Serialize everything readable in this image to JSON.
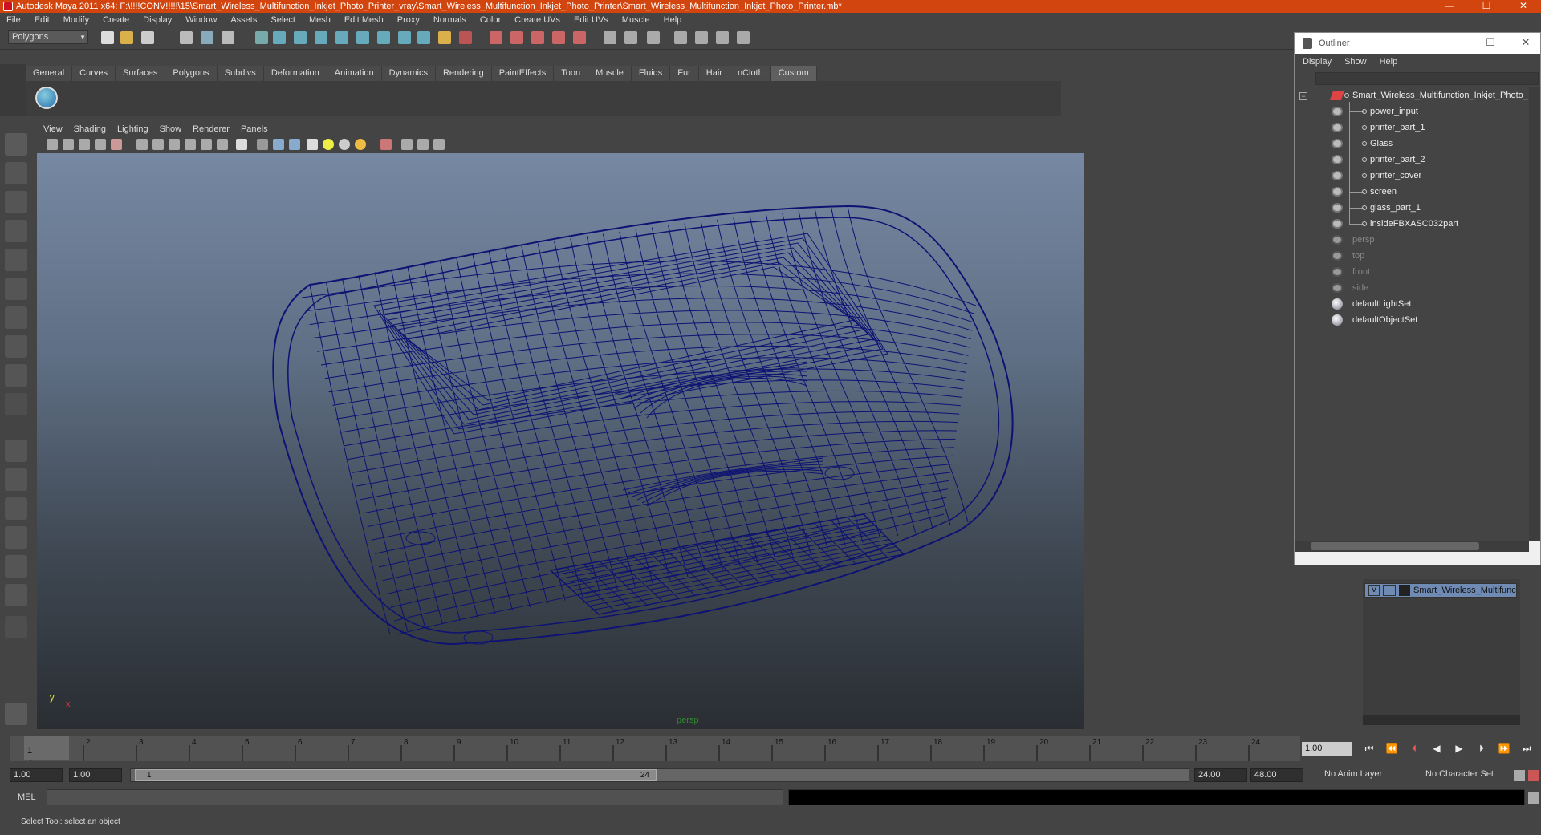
{
  "window": {
    "title": "Autodesk Maya 2011 x64: F:\\!!!!CONV!!!!!\\15\\Smart_Wireless_Multifunction_Inkjet_Photo_Printer_vray\\Smart_Wireless_Multifunction_Inkjet_Photo_Printer\\Smart_Wireless_Multifunction_Inkjet_Photo_Printer.mb*",
    "minimize": "—",
    "maximize": "☐",
    "close": "✕"
  },
  "menu": [
    "File",
    "Edit",
    "Modify",
    "Create",
    "Display",
    "Window",
    "Assets",
    "Select",
    "Mesh",
    "Edit Mesh",
    "Proxy",
    "Normals",
    "Color",
    "Create UVs",
    "Edit UVs",
    "Muscle",
    "Help"
  ],
  "mode_selector": "Polygons",
  "shelf_tabs": [
    "General",
    "Curves",
    "Surfaces",
    "Polygons",
    "Subdivs",
    "Deformation",
    "Animation",
    "Dynamics",
    "Rendering",
    "PaintEffects",
    "Toon",
    "Muscle",
    "Fluids",
    "Fur",
    "Hair",
    "nCloth",
    "Custom"
  ],
  "active_shelf_tab": "Custom",
  "viewport": {
    "menu": [
      "View",
      "Shading",
      "Lighting",
      "Show",
      "Renderer",
      "Panels"
    ],
    "camera_label": "persp",
    "axis_x": "x",
    "axis_y": "y",
    "wire_color": "#0d1273"
  },
  "timeline": {
    "ticks": [
      "1",
      "2",
      "3",
      "4",
      "5",
      "6",
      "7",
      "8",
      "9",
      "10",
      "11",
      "12",
      "13",
      "14",
      "15",
      "16",
      "17",
      "18",
      "19",
      "20",
      "21",
      "22",
      "23",
      "24"
    ],
    "current_marker": "1",
    "current_frame": "1.00"
  },
  "range": {
    "start_time": "1.00",
    "playback_start": "1.00",
    "range_start": "1",
    "range_end": "24",
    "playback_end": "24.00",
    "end_time": "48.00",
    "anim_layer": "No Anim Layer",
    "character_set": "No Character Set"
  },
  "mel": {
    "label": "MEL"
  },
  "help_line": "Select Tool: select an object",
  "outliner": {
    "title": "Outliner",
    "menu": [
      "Display",
      "Show",
      "Help"
    ],
    "root": "Smart_Wireless_Multifunction_Inkjet_Photo_",
    "children": [
      "power_input",
      "printer_part_1",
      "Glass",
      "printer_part_2",
      "printer_cover",
      "screen",
      "glass_part_1",
      "insideFBXASC032part"
    ],
    "cameras": [
      "persp",
      "top",
      "front",
      "side"
    ],
    "sets": [
      "defaultLightSet",
      "defaultObjectSet"
    ]
  },
  "layers": {
    "visible": "V",
    "name": "Smart_Wireless_Multifunc"
  }
}
